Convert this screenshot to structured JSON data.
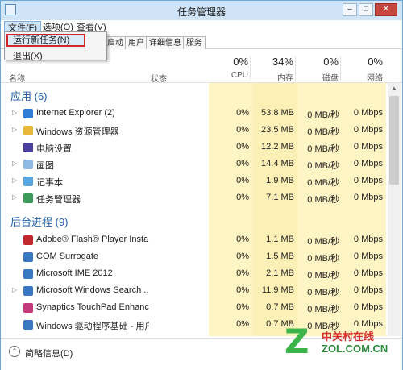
{
  "window": {
    "title": "任务管理器"
  },
  "menu": {
    "file": "文件(F)",
    "options": "选项(O)",
    "view": "查看(V)"
  },
  "file_menu": {
    "run_new_task": "运行新任务(N)",
    "exit": "退出(X)"
  },
  "tabs": {
    "startup_fragment": "启动",
    "users": "用户",
    "details": "详细信息",
    "services": "服务"
  },
  "columns": {
    "name": "名称",
    "status": "状态",
    "cpu": {
      "pct": "0%",
      "label": "CPU"
    },
    "memory": {
      "pct": "34%",
      "label": "内存"
    },
    "disk": {
      "pct": "0%",
      "label": "磁盘"
    },
    "network": {
      "pct": "0%",
      "label": "网络"
    }
  },
  "groups": {
    "apps": {
      "title": "应用 (6)",
      "rows": [
        {
          "name": "Internet Explorer (2)",
          "cpu": "0%",
          "mem": "53.8 MB",
          "disk": "0 MB/秒",
          "net": "0 Mbps",
          "icon": "ie-icon",
          "color": "#2f7fd6",
          "expandable": true
        },
        {
          "name": "Windows 资源管理器",
          "cpu": "0%",
          "mem": "23.5 MB",
          "disk": "0 MB/秒",
          "net": "0 Mbps",
          "icon": "folder-icon",
          "color": "#e8b73a",
          "expandable": true
        },
        {
          "name": "电脑设置",
          "cpu": "0%",
          "mem": "12.2 MB",
          "disk": "0 MB/秒",
          "net": "0 Mbps",
          "icon": "settings-icon",
          "color": "#4a3f9a",
          "expandable": false
        },
        {
          "name": "画图",
          "cpu": "0%",
          "mem": "14.4 MB",
          "disk": "0 MB/秒",
          "net": "0 Mbps",
          "icon": "paint-icon",
          "color": "#8fb9e0",
          "expandable": true
        },
        {
          "name": "记事本",
          "cpu": "0%",
          "mem": "1.9 MB",
          "disk": "0 MB/秒",
          "net": "0 Mbps",
          "icon": "notepad-icon",
          "color": "#5aa7df",
          "expandable": true
        },
        {
          "name": "任务管理器",
          "cpu": "0%",
          "mem": "7.1 MB",
          "disk": "0 MB/秒",
          "net": "0 Mbps",
          "icon": "taskmgr-icon",
          "color": "#3d9a5b",
          "expandable": true
        }
      ]
    },
    "background": {
      "title": "后台进程 (9)",
      "rows": [
        {
          "name": "Adobe® Flash® Player Insta...",
          "cpu": "0%",
          "mem": "1.1 MB",
          "disk": "0 MB/秒",
          "net": "0 Mbps",
          "icon": "flash-icon",
          "color": "#c0282d",
          "expandable": false
        },
        {
          "name": "COM Surrogate",
          "cpu": "0%",
          "mem": "1.5 MB",
          "disk": "0 MB/秒",
          "net": "0 Mbps",
          "icon": "com-icon",
          "color": "#3a78c2",
          "expandable": false
        },
        {
          "name": "Microsoft IME 2012",
          "cpu": "0%",
          "mem": "2.1 MB",
          "disk": "0 MB/秒",
          "net": "0 Mbps",
          "icon": "ime-icon",
          "color": "#3a78c2",
          "expandable": false
        },
        {
          "name": "Microsoft Windows Search ...",
          "cpu": "0%",
          "mem": "11.9 MB",
          "disk": "0 MB/秒",
          "net": "0 Mbps",
          "icon": "search-indexer-icon",
          "color": "#3a78c2",
          "expandable": true
        },
        {
          "name": "Synaptics TouchPad Enhance...",
          "cpu": "0%",
          "mem": "0.7 MB",
          "disk": "0 MB/秒",
          "net": "0 Mbps",
          "icon": "touchpad-icon",
          "color": "#c43a7a",
          "expandable": false
        },
        {
          "name": "Windows 驱动程序基础 - 用户...",
          "cpu": "0%",
          "mem": "0.7 MB",
          "disk": "0 MB/秒",
          "net": "0 Mbps",
          "icon": "driver-icon",
          "color": "#3a78c2",
          "expandable": false
        }
      ]
    }
  },
  "footer": {
    "fewer_details": "简略信息(D)"
  },
  "watermark": {
    "letter": "Z",
    "cn": "中关村在线",
    "en": "ZOL.COM.CN"
  }
}
